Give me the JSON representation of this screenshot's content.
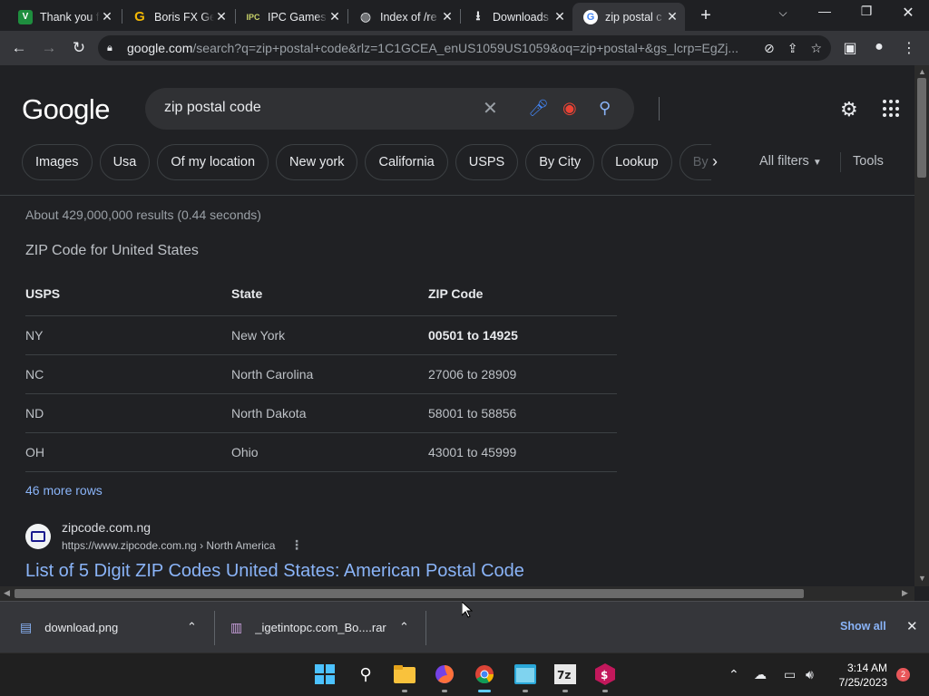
{
  "tabs": [
    {
      "title": "Thank you f",
      "favicon": "green-v-icon"
    },
    {
      "title": "Boris FX Ge",
      "favicon": "gold-g-icon"
    },
    {
      "title": "IPC Games",
      "favicon": "ipc-games-icon"
    },
    {
      "title": "Index of /re",
      "favicon": "globe-icon"
    },
    {
      "title": "Downloads",
      "favicon": "download-icon"
    },
    {
      "title": "zip postal c",
      "favicon": "google-icon"
    }
  ],
  "address_bar": {
    "host": "google.com",
    "path": "/search?q=zip+postal+code&rlz=1C1GCEA_enUS1059US1059&oq=zip+postal+&gs_lcrp=EgZj..."
  },
  "google": {
    "logo": "Google",
    "query": "zip postal code",
    "chips": [
      "Images",
      "Usa",
      "Of my location",
      "New york",
      "California",
      "USPS",
      "By City",
      "Lookup",
      "By cit"
    ],
    "all_filters": "All filters",
    "tools": "Tools",
    "stats": "About 429,000,000 results (0.44 seconds)",
    "snippet_title": "ZIP Code for United States",
    "table": {
      "headers": [
        "USPS",
        "State",
        "ZIP Code"
      ],
      "rows": [
        [
          "NY",
          "New York",
          "00501 to 14925"
        ],
        [
          "NC",
          "North Carolina",
          "27006 to 28909"
        ],
        [
          "ND",
          "North Dakota",
          "58001 to 58856"
        ],
        [
          "OH",
          "Ohio",
          "43001 to 45999"
        ]
      ]
    },
    "more_rows": "46 more rows",
    "result": {
      "site_name": "zipcode.com.ng",
      "url": "https://www.zipcode.com.ng › North America",
      "title": "List of 5 Digit ZIP Codes United States: American Postal Code"
    }
  },
  "downloads": {
    "items": [
      "download.png",
      "_igetintopc.com_Bo....rar"
    ],
    "show_all": "Show all"
  },
  "taskbar": {
    "time": "3:14 AM",
    "date": "7/25/2023",
    "notifications": "2"
  }
}
